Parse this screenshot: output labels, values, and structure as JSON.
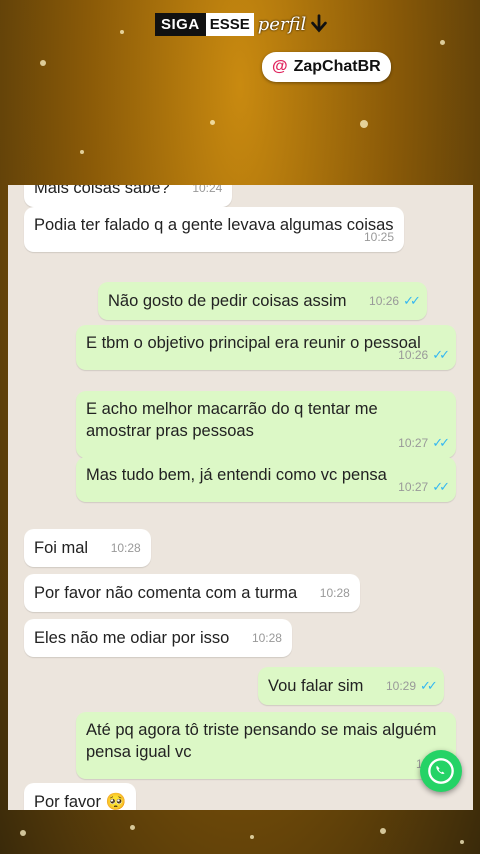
{
  "promo": {
    "siga": "SIGA",
    "esse": "ESSE",
    "perfil": "perfil",
    "handle_at": "@",
    "handle_name": "ZapChatBR"
  },
  "messages": [
    {
      "dir": "in",
      "text": "Mais coisas sabe?",
      "time": "10:24"
    },
    {
      "dir": "in",
      "text": "Podia ter falado q a gente levava algumas coisas",
      "time": "10:25"
    },
    {
      "dir": "out",
      "text": "Não gosto de pedir coisas assim",
      "time": "10:26"
    },
    {
      "dir": "out",
      "text": "E tbm o objetivo principal era reunir o pessoal",
      "time": "10:26"
    },
    {
      "dir": "out",
      "text": "E acho melhor macarrão do q tentar me amostrar pras pessoas",
      "time": "10:27"
    },
    {
      "dir": "out",
      "text": "Mas tudo bem, já entendi como vc pensa",
      "time": "10:27"
    },
    {
      "dir": "in",
      "text": "Foi mal",
      "time": "10:28"
    },
    {
      "dir": "in",
      "text": "Por favor não comenta com a turma",
      "time": "10:28"
    },
    {
      "dir": "in",
      "text": "Eles não me odiar por isso",
      "time": "10:28"
    },
    {
      "dir": "out",
      "text": "Vou falar sim",
      "time": "10:29"
    },
    {
      "dir": "out",
      "text": "Até pq agora tô triste pensando se mais alguém pensa igual vc",
      "time": "10:29"
    },
    {
      "dir": "in",
      "text": "Por favor 🥺",
      "time": ""
    }
  ],
  "colors": {
    "incoming": "#ffffff",
    "outgoing": "#dcf8c6",
    "chat_bg": "#ece5dd",
    "read_ticks": "#34b7f1",
    "whatsapp_green": "#25d366"
  },
  "icons": {
    "read": "double-check-icon",
    "fab": "whatsapp-icon",
    "arrow": "arrow-down-icon"
  }
}
